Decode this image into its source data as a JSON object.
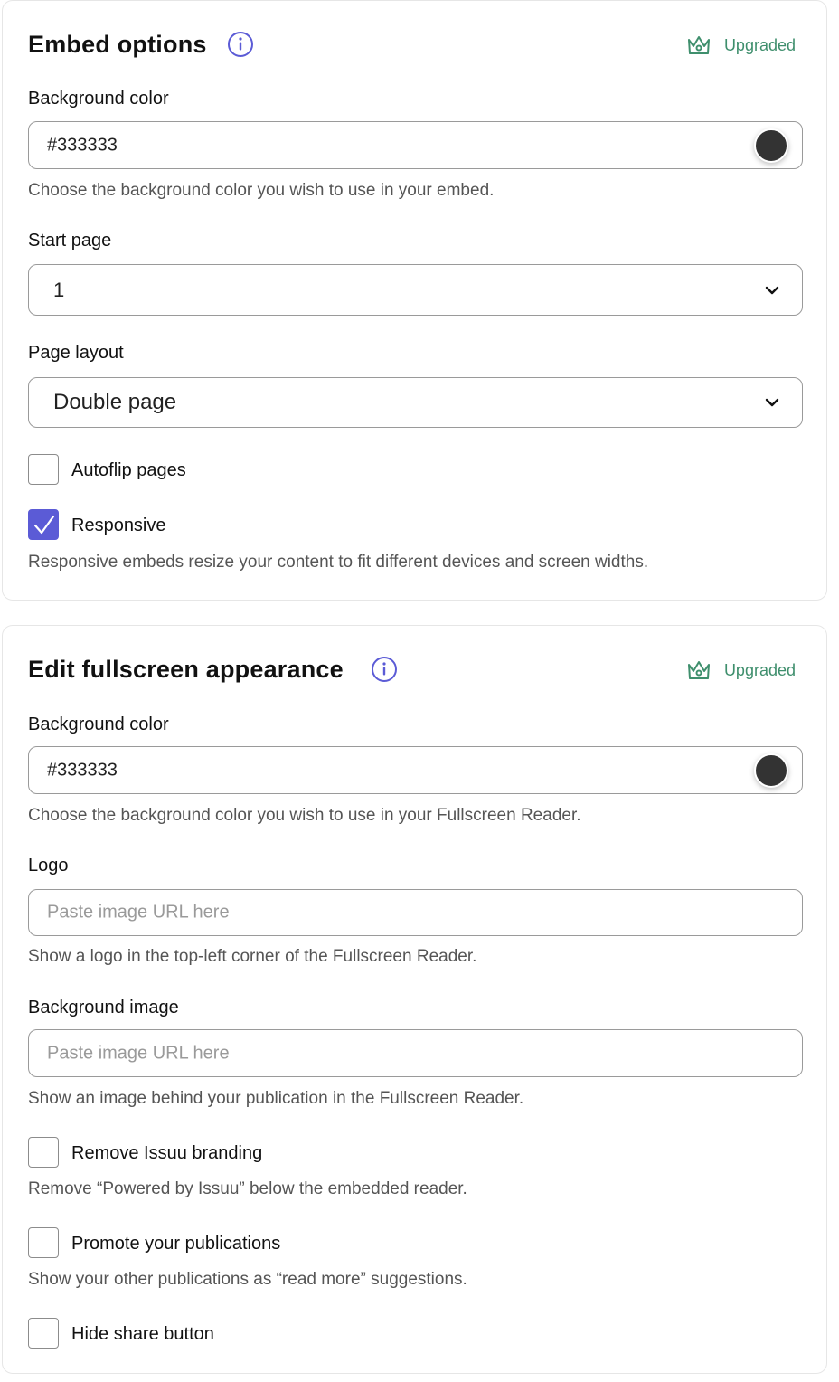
{
  "embed_options": {
    "title": "Embed options",
    "badge": "Upgraded",
    "background_color": {
      "label": "Background color",
      "value": "#333333",
      "swatch_color": "#333333",
      "help": "Choose the background color you wish to use in your embed."
    },
    "start_page": {
      "label": "Start page",
      "value": "1"
    },
    "page_layout": {
      "label": "Page layout",
      "value": "Double page"
    },
    "autoflip": {
      "label": "Autoflip pages",
      "checked": false
    },
    "responsive": {
      "label": "Responsive",
      "checked": true,
      "help": "Responsive embeds resize your content to fit different devices and screen widths."
    }
  },
  "fullscreen": {
    "title": "Edit fullscreen appearance",
    "badge": "Upgraded",
    "background_color": {
      "label": "Background color",
      "value": "#333333",
      "swatch_color": "#333333",
      "help": "Choose the background color you wish to use in your Fullscreen Reader."
    },
    "logo": {
      "label": "Logo",
      "placeholder": "Paste image URL here",
      "help": "Show a logo in the top-left corner of the Fullscreen Reader."
    },
    "background_image": {
      "label": "Background image",
      "placeholder": "Paste image URL here",
      "help": "Show an image behind your publication in the Fullscreen Reader."
    },
    "remove_branding": {
      "label": "Remove Issuu branding",
      "checked": false,
      "help": "Remove “Powered by Issuu” below the embedded reader."
    },
    "promote": {
      "label": "Promote your publications",
      "checked": false,
      "help": "Show your other publications as “read more” suggestions."
    },
    "hide_share": {
      "label": "Hide share button",
      "checked": false
    }
  },
  "colors": {
    "accent": "#5b5bd6",
    "upgraded": "#3f8f6d",
    "border": "#9a9a9a"
  },
  "icons": {
    "info": "info-icon",
    "crown": "crown-icon",
    "chevron": "chevron-down-icon",
    "check": "check-icon"
  }
}
